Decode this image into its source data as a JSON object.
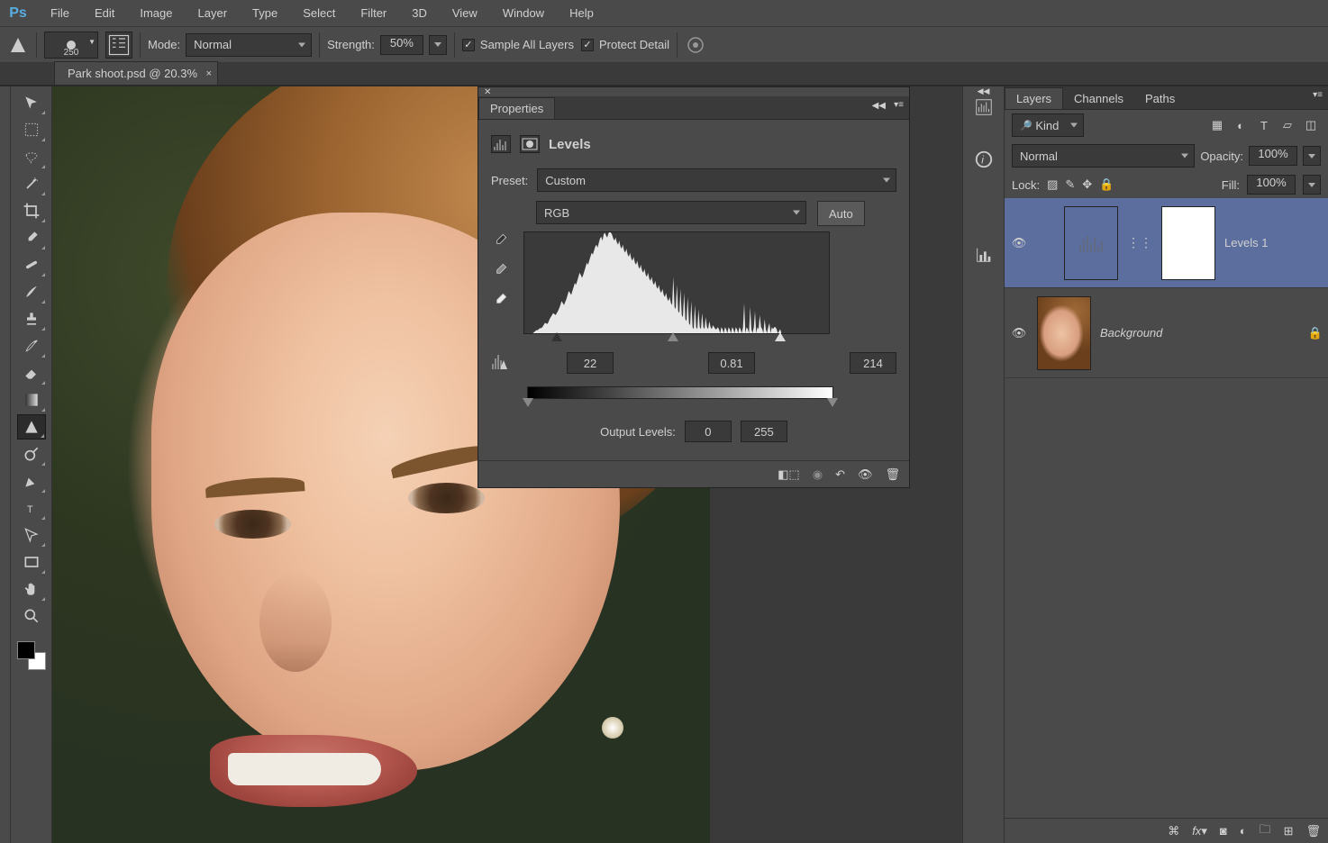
{
  "app": {
    "logo": "Ps"
  },
  "menu": [
    "File",
    "Edit",
    "Image",
    "Layer",
    "Type",
    "Select",
    "Filter",
    "3D",
    "View",
    "Window",
    "Help"
  ],
  "options": {
    "brush_size": "250",
    "mode_label": "Mode:",
    "mode_value": "Normal",
    "strength_label": "Strength:",
    "strength_value": "50%",
    "sample_all_label": "Sample All Layers",
    "protect_detail_label": "Protect Detail"
  },
  "tab": {
    "label": "Park shoot.psd @ 20.3%",
    "close": "×"
  },
  "properties": {
    "tab": "Properties",
    "title": "Levels",
    "preset_label": "Preset:",
    "preset_value": "Custom",
    "channel_value": "RGB",
    "auto_label": "Auto",
    "input_black": "22",
    "input_gamma": "0.81",
    "input_white": "214",
    "output_label": "Output Levels:",
    "output_black": "0",
    "output_white": "255"
  },
  "layers_panel": {
    "tabs": [
      "Layers",
      "Channels",
      "Paths"
    ],
    "filter_kind": "Kind",
    "blend_mode": "Normal",
    "opacity_label": "Opacity:",
    "opacity_value": "100%",
    "lock_label": "Lock:",
    "fill_label": "Fill:",
    "fill_value": "100%",
    "layers": [
      {
        "name": "Levels 1"
      },
      {
        "name": "Background"
      }
    ]
  },
  "chart_data": {
    "type": "histogram",
    "title": "Levels",
    "channel": "RGB",
    "input_range": [
      0,
      255
    ],
    "input_black": 22,
    "input_gamma": 0.81,
    "input_white": 214,
    "output_range": [
      0,
      255
    ],
    "output_black": 0,
    "output_white": 255,
    "bins": [
      0,
      0,
      0,
      0,
      0,
      0,
      0,
      0,
      1,
      2,
      3,
      3,
      4,
      5,
      5,
      6,
      8,
      10,
      10,
      9,
      11,
      14,
      16,
      18,
      20,
      19,
      18,
      20,
      22,
      25,
      28,
      32,
      30,
      28,
      31,
      34,
      38,
      42,
      40,
      38,
      42,
      46,
      50,
      48,
      52,
      56,
      60,
      58,
      55,
      58,
      62,
      66,
      70,
      68,
      72,
      76,
      80,
      78,
      82,
      86,
      88,
      85,
      90,
      94,
      96,
      92,
      98,
      100,
      97,
      95,
      99,
      102,
      100,
      98,
      94,
      92,
      95,
      90,
      88,
      92,
      86,
      84,
      88,
      82,
      80,
      84,
      78,
      76,
      80,
      74,
      72,
      76,
      70,
      68,
      72,
      66,
      64,
      68,
      62,
      60,
      64,
      58,
      56,
      60,
      54,
      52,
      56,
      50,
      48,
      52,
      46,
      44,
      48,
      42,
      40,
      44,
      38,
      36,
      40,
      34,
      32,
      36,
      30,
      28,
      56,
      26,
      24,
      48,
      22,
      20,
      44,
      18,
      16,
      40,
      14,
      12,
      36,
      10,
      8,
      32,
      6,
      4,
      28,
      6,
      4,
      24,
      6,
      4,
      20,
      6,
      4,
      16,
      6,
      4,
      12,
      6,
      4,
      8,
      6,
      4,
      4,
      6,
      4,
      0,
      6,
      4,
      0,
      6,
      4,
      0,
      6,
      4,
      0,
      6,
      4,
      0,
      6,
      4,
      0,
      6,
      4,
      0,
      6,
      30,
      0,
      6,
      4,
      0,
      26,
      4,
      0,
      6,
      22,
      0,
      6,
      4,
      18,
      6,
      4,
      0,
      14,
      4,
      0,
      6,
      10,
      0,
      6,
      4,
      6,
      6,
      4,
      0,
      2,
      4,
      0,
      0,
      0,
      0,
      0,
      0,
      0,
      0,
      0,
      0,
      0,
      0,
      0,
      0,
      0,
      0,
      0,
      0,
      0,
      0,
      0,
      0,
      0,
      0,
      0,
      0,
      0,
      0,
      0,
      0,
      0,
      0,
      0,
      0,
      0,
      0,
      0,
      0,
      0,
      0,
      0,
      0
    ]
  }
}
